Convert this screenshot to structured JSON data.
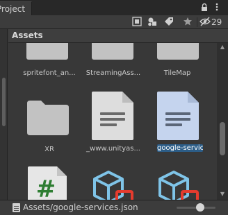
{
  "window": {
    "tab_title": "Project"
  },
  "toolbar": {
    "hidden_count": "29",
    "icons": [
      "lock-icon",
      "more-icon",
      "scene-search-icon",
      "filter-type-icon",
      "label-icon",
      "favorite-star-icon",
      "eye-hidden-icon"
    ]
  },
  "header": {
    "title": "Assets"
  },
  "grid": {
    "items": [
      {
        "label": "spritefont_an...",
        "kind": "folder"
      },
      {
        "label": "StreamingAss...",
        "kind": "folder"
      },
      {
        "label": "TileMap",
        "kind": "folder"
      },
      {
        "label": "XR",
        "kind": "folder"
      },
      {
        "label": "_www.unityas...",
        "kind": "text-file"
      },
      {
        "label": "google-servic...",
        "kind": "text-file",
        "selected": true
      },
      {
        "label": "",
        "kind": "csharp-script"
      },
      {
        "label": "",
        "kind": "prefab"
      },
      {
        "label": "",
        "kind": "prefab"
      }
    ]
  },
  "status": {
    "path": "Assets/google-services.json",
    "zoom": 0.6
  },
  "colors": {
    "selection": "#2c5d87",
    "panel": "#383838",
    "script_green": "#2e7d32"
  }
}
